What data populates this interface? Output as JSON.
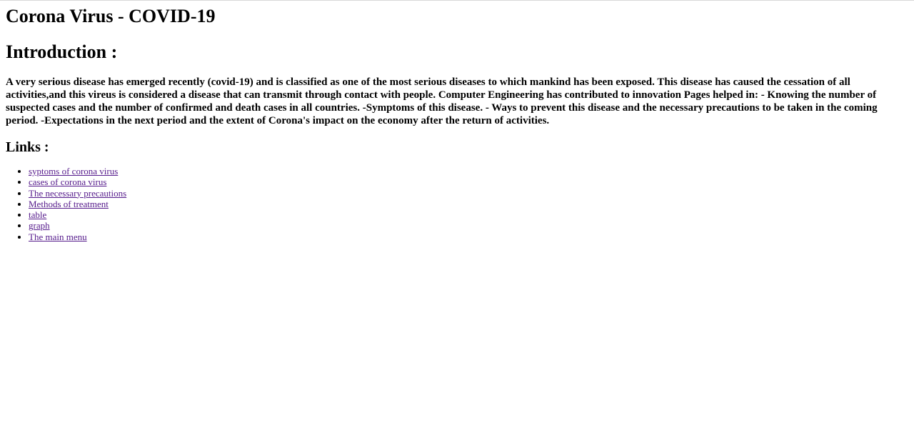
{
  "page": {
    "title": "Corona Virus - COVID-19",
    "intro_heading": "Introduction :",
    "intro_text": "A very serious disease has emerged recently (covid-19) and is classified as one of the most serious diseases to which mankind has been exposed. This disease has caused the cessation of all activities,and this vireus is considered a disease that can transmit through contact with people. Computer Engineering has contributed to innovation Pages helped in: - Knowing the number of suspected cases and the number of confirmed and death cases in all countries. -Symptoms of this disease. - Ways to prevent this disease and the necessary precautions to be taken in the coming period. -Expectations in the next period and the extent of Corona's impact on the economy after the return of activities.",
    "links_heading": "Links :"
  },
  "links": [
    {
      "label": "syptoms of corona virus"
    },
    {
      "label": "cases of corona virus"
    },
    {
      "label": "The necessary precautions"
    },
    {
      "label": "Methods of treatment"
    },
    {
      "label": "table"
    },
    {
      "label": "graph"
    },
    {
      "label": "The main menu"
    }
  ],
  "colors": {
    "link_visited": "#551a8b",
    "text": "#000000",
    "background": "#ffffff"
  }
}
